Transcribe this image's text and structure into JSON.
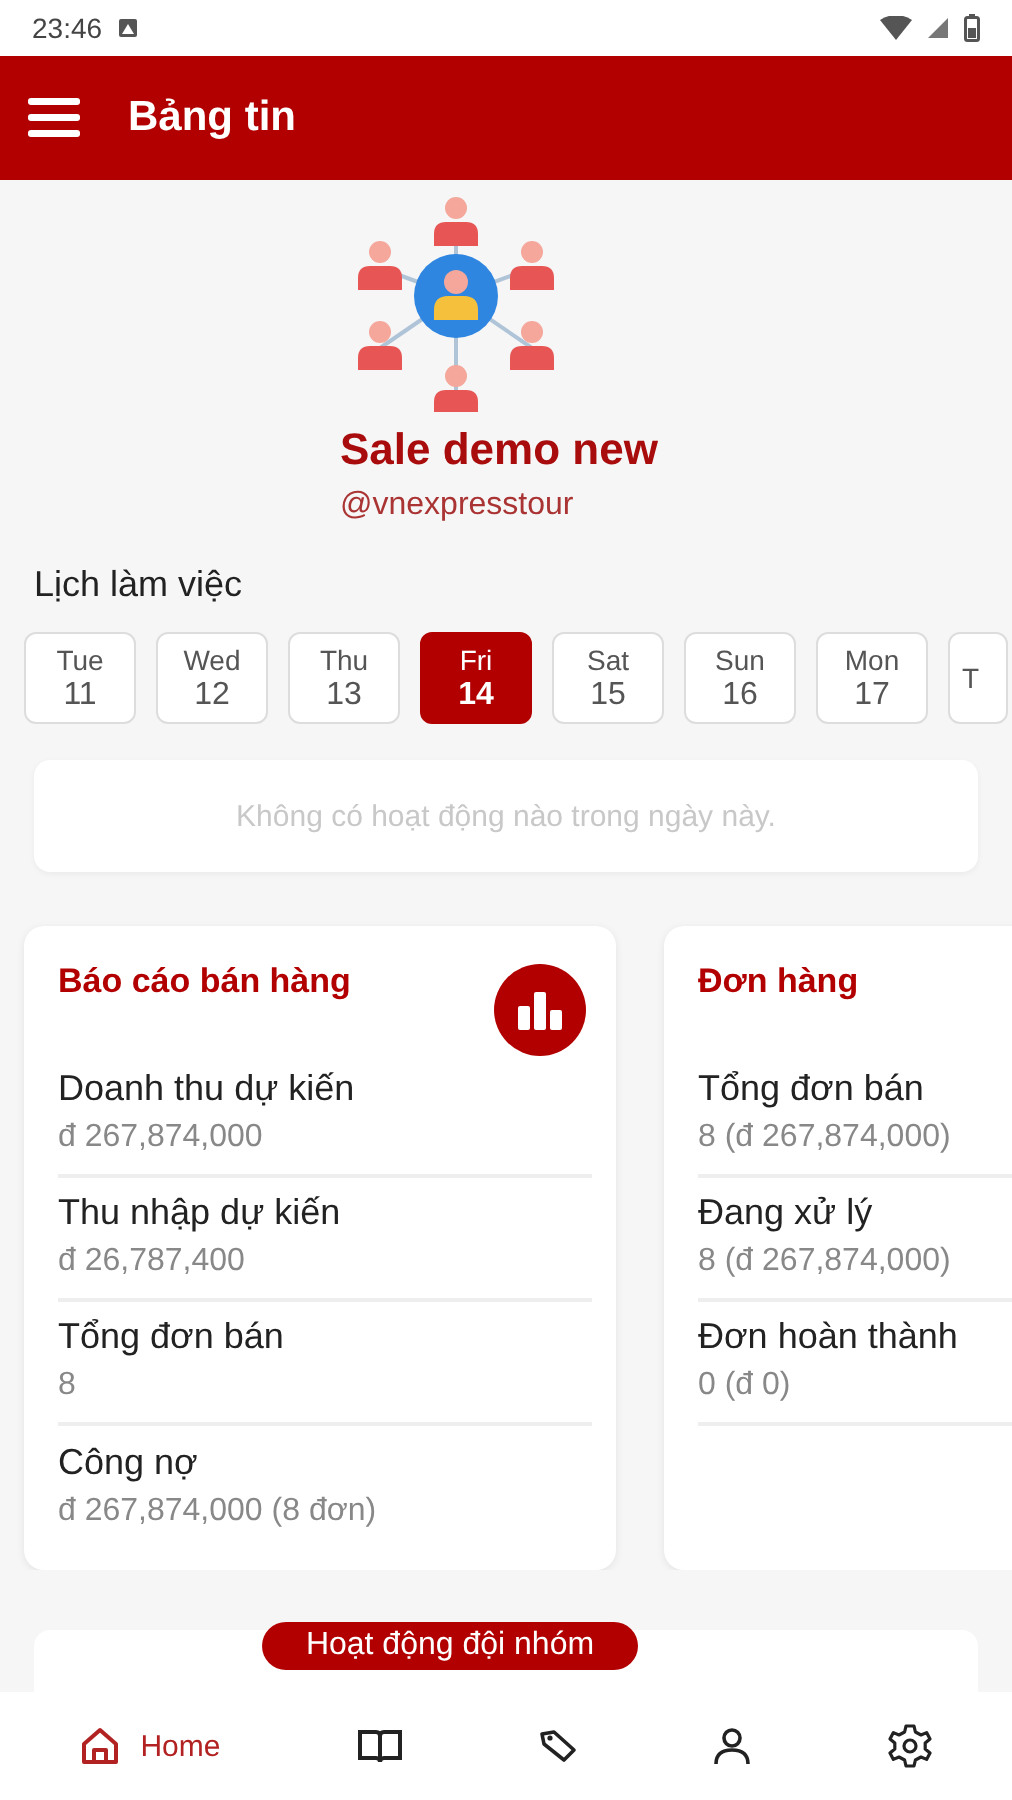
{
  "status_bar": {
    "time": "23:46"
  },
  "app_bar": {
    "title": "Bảng tin"
  },
  "profile": {
    "name": "Sale demo new",
    "handle": "@vnexpresstour"
  },
  "schedule": {
    "title": "Lịch làm việc",
    "empty_message": "Không có hoạt động nào trong ngày này.",
    "days": [
      {
        "label": "Tue",
        "day": "11",
        "selected": false
      },
      {
        "label": "Wed",
        "day": "12",
        "selected": false
      },
      {
        "label": "Thu",
        "day": "13",
        "selected": false
      },
      {
        "label": "Fri",
        "day": "14",
        "selected": true
      },
      {
        "label": "Sat",
        "day": "15",
        "selected": false
      },
      {
        "label": "Sun",
        "day": "16",
        "selected": false
      },
      {
        "label": "Mon",
        "day": "17",
        "selected": false
      },
      {
        "label": "T",
        "selected": false
      }
    ]
  },
  "cards": [
    {
      "title": "Báo cáo bán hàng",
      "chart_button": true,
      "rows": [
        {
          "label": "Doanh thu dự kiến",
          "value": "đ 267,874,000"
        },
        {
          "label": "Thu nhập dự kiến",
          "value": "đ 26,787,400"
        },
        {
          "label": "Tổng đơn bán",
          "value": "8"
        },
        {
          "label": "Công nợ",
          "value": "đ 267,874,000 (8 đơn)"
        }
      ]
    },
    {
      "title": "Đơn hàng",
      "chart_button": false,
      "rows": [
        {
          "label": "Tổng đơn bán",
          "value": "8 (đ 267,874,000)"
        },
        {
          "label": "Đang xử lý",
          "value": "8 (đ 267,874,000)"
        },
        {
          "label": "Đơn hoàn thành",
          "value": "0 (đ 0)"
        }
      ]
    }
  ],
  "team_activity": {
    "title": "Hoạt động đội nhóm"
  },
  "bottom_nav": [
    {
      "kind": "home",
      "label": "Home",
      "selected": true
    },
    {
      "kind": "book",
      "selected": false
    },
    {
      "kind": "tag",
      "selected": false
    },
    {
      "kind": "person",
      "selected": false
    },
    {
      "kind": "settings",
      "selected": false
    }
  ]
}
